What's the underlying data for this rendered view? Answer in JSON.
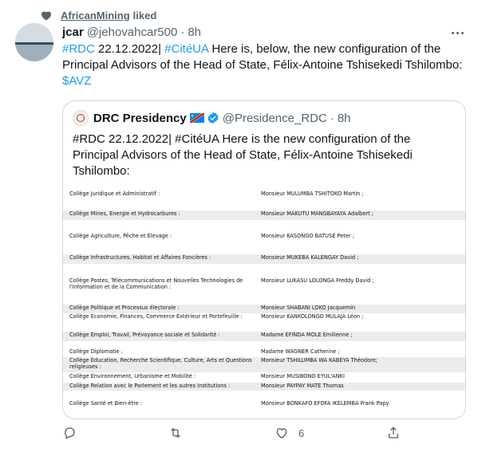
{
  "context": {
    "user": "AfricanMining",
    "action": "liked"
  },
  "tweet": {
    "name": "jcar",
    "handle": "@jehovahcar500",
    "separator": "·",
    "time": "8h",
    "text_parts": [
      {
        "t": "#RDC",
        "link": true
      },
      {
        "t": " 22.12.2022|  ",
        "link": false
      },
      {
        "t": "#CitéUA",
        "link": true
      },
      {
        "t": " Here is, below, the new configuration of the Principal Advisors of the Head of State, Félix-Antoine Tshisekedi Tshilombo: ",
        "link": false
      },
      {
        "t": "$AVZ",
        "link": true
      }
    ]
  },
  "quote": {
    "name": "DRC Presidency",
    "handle": "@Presidence_RDC",
    "separator": "·",
    "time": "8h",
    "text": "#RDC 22.12.2022| #CitéUA Here is the new configuration of the Principal Advisors of the Head of State, Félix-Antoine Tshisekedi Tshilombo:"
  },
  "document_rows": [
    {
      "college": "Collège Juridique et Administratif :",
      "advisor": "Monsieur MULUMBA TSHITOKO Martin ;"
    },
    {
      "college": "Collège Mines, Energie et Hydrocarbures :",
      "advisor": "Monsieur MAKUTU MANGBAYAYA Adalbert ;"
    },
    {
      "college": "Collège Agriculture, Pêche et Elevage :",
      "advisor": "Monsieur KASONGO BATUSE Peter ;"
    },
    {
      "college": "Collège Infrastructures, Habitat et Affaires Foncières :",
      "advisor": "Monsieur MUKEBA KALENGAY David ;"
    },
    {
      "college": "Collège Postes, Télécommunications et Nouvelles  Technologies de l'Information et de la Communication :",
      "advisor": "Monsieur LUKASU LOLONGA Freddy David ;"
    },
    {
      "college": "Collège Politique et Processus électorale :",
      "advisor": "Monsieur SHABANI LOKO Jacquemin"
    },
    {
      "college": "Collège Economie, Finances, Commerce Extérieur et Portefeuille :",
      "advisor": "Monsieur KANKOLONGO MULAJA Léon ;"
    },
    {
      "college": "Collège Emploi, Travail, Prévoyance sociale et Solidarité :",
      "advisor": "Madame EFINDA MOLE Emilienne ;"
    },
    {
      "college": "Collège Diplomatie :",
      "advisor": "Madame WAGNER Catherine ;"
    },
    {
      "college": "Collège Education, Recherche Scientifique, Culture, Arts et Questions religieuses :",
      "advisor": "Monsieur TSHILUMBA WA KABEYA Théodore;"
    },
    {
      "college": "Collège Environnement, Urbanisme et Mobilité :",
      "advisor": "Monsieur MUSIBONO EYUL'ANKI"
    },
    {
      "college": "Collège Relation avec le Parlement et les autres Institutions :",
      "advisor": "Monsieur PAYPAY MATE Thomas"
    },
    {
      "college": "Collège Santé et Bien-être :",
      "advisor": "Monsieur BONKAFO EFOFA IKELEMBA Frank Papy"
    }
  ],
  "actions": {
    "like_count": "6"
  },
  "colors": {
    "link": "#1d9bf0",
    "secondary": "#536471",
    "like": "#536471"
  }
}
